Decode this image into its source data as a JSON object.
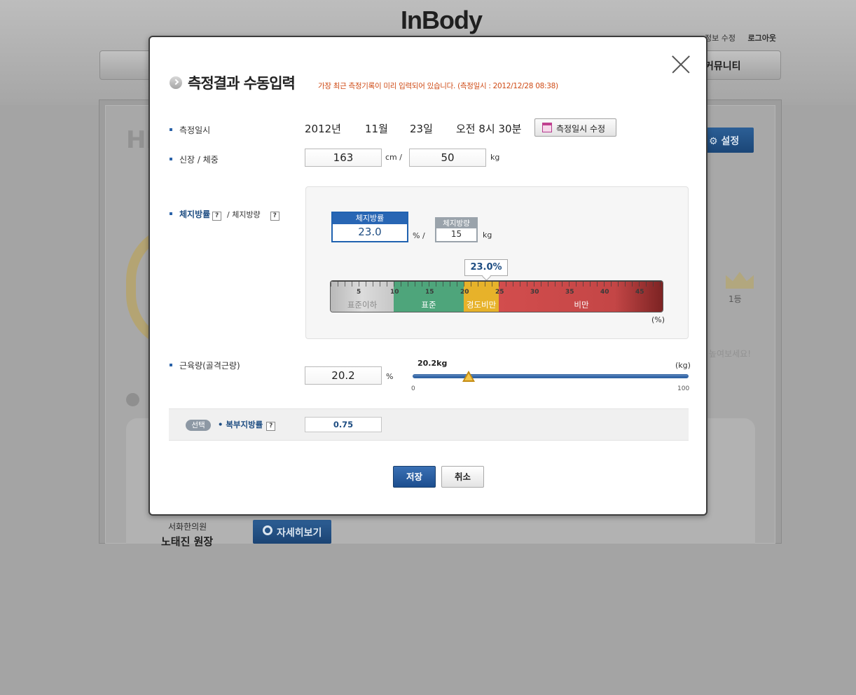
{
  "background": {
    "logo": "InBody",
    "header_links": [
      "정보 수정",
      "로그아웃"
    ],
    "nav_item": "커뮤니티",
    "big_heading": "HI",
    "settings_button": "설정",
    "rank": "1등",
    "hint": "높여보세요!",
    "clinic": "서화한의원",
    "doctor": "노태진 원장",
    "detail_button": "자세히보기"
  },
  "modal": {
    "title": "측정결과 수동입력",
    "notice": "가장 최근 측정기록이 미리 입력되어 있습니다. (측정일시 : 2012/12/28 08:38)",
    "date": {
      "label": "측정일시",
      "year": "2012년",
      "month": "11월",
      "day": "23일",
      "time": "오전 8시 30분",
      "edit_button": "측정일시 수정"
    },
    "height_weight": {
      "label": "신장 / 체중",
      "height": "163",
      "height_unit": "cm /",
      "weight": "50",
      "weight_unit": "kg"
    },
    "body_fat": {
      "label_primary": "체지방률",
      "label_secondary": "/ 체지방량",
      "help": "?",
      "pct_caption": "체지방률",
      "pct_value": "23.0",
      "pct_unit": "% /",
      "kg_caption": "체지방량",
      "kg_value": "15",
      "kg_unit": "kg",
      "bubble": "23.0%",
      "scale_unit": "(%)",
      "scale_ticks": [
        "5",
        "10",
        "15",
        "20",
        "25",
        "30",
        "35",
        "40",
        "45"
      ],
      "segments": [
        {
          "label": "표준이하",
          "color": "#cfcfcf"
        },
        {
          "label": "표준",
          "color": "#4ea57b"
        },
        {
          "label": "경도비만",
          "color": "#e7b22a"
        },
        {
          "label": "비만",
          "color": "#cc4949"
        }
      ]
    },
    "muscle": {
      "label": "근육량(골격근량)",
      "value": "20.2",
      "unit": "%",
      "slider_value_label": "20.2kg",
      "slider_unit": "(kg)",
      "min": "0",
      "max": "100",
      "slider_fraction": 0.202
    },
    "optional": {
      "badge": "선택",
      "label": "• 복부지방률",
      "help": "?",
      "value": "0.75"
    },
    "buttons": {
      "save": "저장",
      "cancel": "취소"
    }
  }
}
